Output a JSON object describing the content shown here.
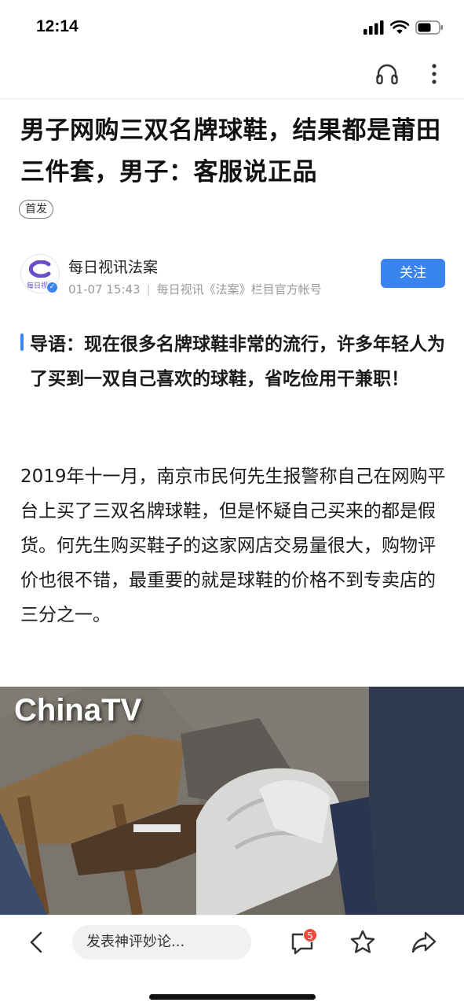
{
  "status_bar": {
    "time": "12:14",
    "icons": [
      "signal-icon",
      "wifi-icon",
      "battery-icon"
    ]
  },
  "top_bar": {
    "icons": [
      "headphones-icon",
      "more-icon"
    ]
  },
  "article": {
    "title": "男子网购三双名牌球鞋，结果都是莆田三件套，男子：客服说正品",
    "badge": "首发",
    "author": {
      "name": "每日视讯法案",
      "avatar_text": "每日视讯",
      "timestamp": "01-07 15:43",
      "description": "每日视讯《法案》栏目官方帐号",
      "follow_label": "关注"
    },
    "lead": "导语：现在很多名牌球鞋非常的流行，许多年轻人为了买到一双自己喜欢的球鞋，省吃俭用干兼职！",
    "paragraph": "2019年十一月，南京市民何先生报警称自己在网购平台上买了三双名牌球鞋，但是怀疑自己买来的都是假货。何先生购买鞋子的这家网店交易量很大，购物评价也很不错，最重要的就是球鞋的价格不到专卖店的三分之一。",
    "video": {
      "watermark": "ChinaTV"
    }
  },
  "bottom_bar": {
    "comment_placeholder": "发表神评妙论...",
    "comment_count": "5",
    "icons": [
      "back-icon",
      "comment-icon",
      "star-icon",
      "share-icon"
    ]
  },
  "colors": {
    "accent": "#3a84f0",
    "badge_red": "#f04a3a",
    "text": "#1a1a1a",
    "muted": "#999999"
  }
}
